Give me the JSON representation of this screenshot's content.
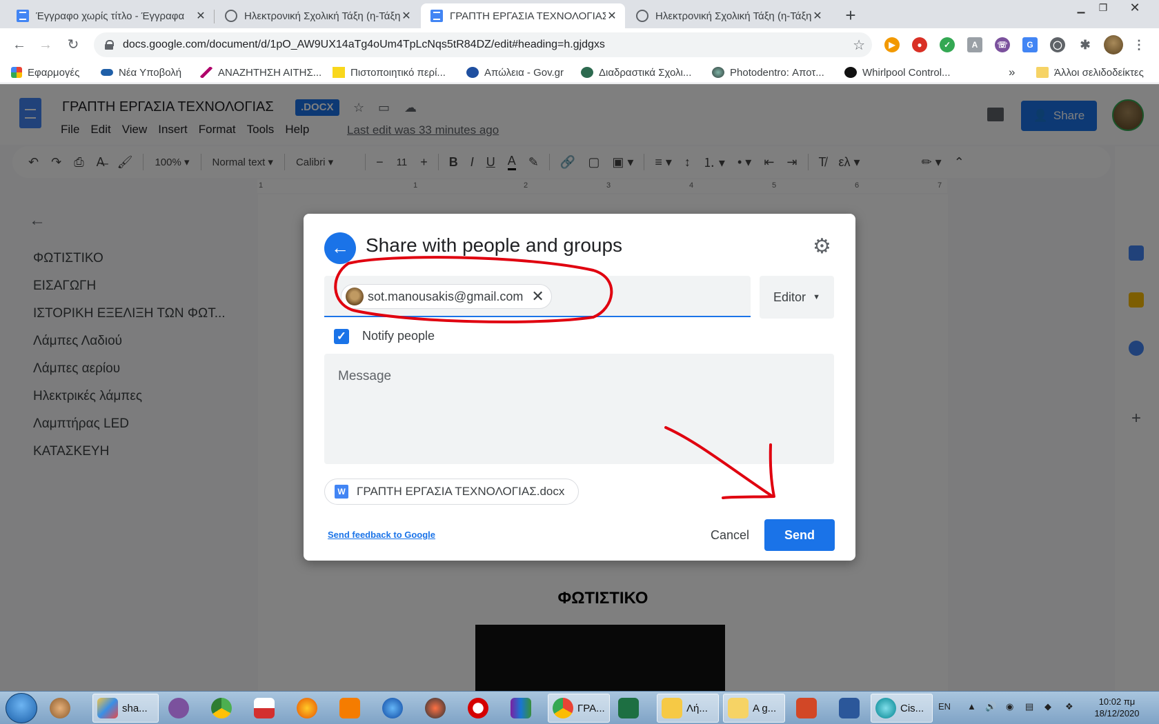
{
  "browser": {
    "tabs": [
      {
        "title": "Έγγραφο χωρίς τίτλο - Έγγραφα",
        "icon": "docs-icon",
        "active": false
      },
      {
        "title": "Ηλεκτρονική Σχολική Τάξη (η-Τάξη)",
        "icon": "eclass-icon",
        "active": false
      },
      {
        "title": "ΓΡΑΠΤΗ ΕΡΓΑΣΙΑ ΤΕΧΝΟΛΟΓΙΑΣ",
        "icon": "docs-icon",
        "active": true
      },
      {
        "title": "Ηλεκτρονική Σχολική Τάξη (η-Τάξη)",
        "icon": "eclass-icon",
        "active": false
      }
    ],
    "url": "docs.google.com/document/d/1pO_AW9UX14aTg4oUm4TpLcNqs5tR84DZ/edit#heading=h.gjdgxs",
    "bookmarks": [
      {
        "label": "Εφαρμογές"
      },
      {
        "label": "Νέα Υποβολή"
      },
      {
        "label": "ΑΝΑΖΗΤΗΣΗ ΑΙΤΗΣ..."
      },
      {
        "label": "Πιστοποιητικό περί..."
      },
      {
        "label": "Απώλεια - Gov.gr"
      },
      {
        "label": "Διαδραστικά Σχολι..."
      },
      {
        "label": "Photodentro: Αποτ..."
      },
      {
        "label": "Whirlpool Control..."
      }
    ],
    "bookmarks_overflow": "»",
    "other_bookmarks": "Άλλοι σελιδοδείκτες"
  },
  "docs": {
    "title": "ΓΡΑΠΤΗ ΕΡΓΑΣΙΑ ΤΕΧΝΟΛΟΓΙΑΣ",
    "badge": ".DOCX",
    "menu": [
      "File",
      "Edit",
      "View",
      "Insert",
      "Format",
      "Tools",
      "Help"
    ],
    "last_edit": "Last edit was 33 minutes ago",
    "share_label": "Share",
    "toolbar": {
      "zoom": "100%",
      "style": "Normal text",
      "font": "Calibri",
      "font_size": "11"
    },
    "ruler": [
      "1",
      "1",
      "2",
      "3",
      "4",
      "5",
      "6",
      "7"
    ],
    "outline": [
      "ΦΩΤΙΣΤΙΚΟ",
      "ΕΙΣΑΓΩΓΗ",
      "ΙΣΤΟΡΙΚΗ ΕΞΕΛΙΞΗ ΤΩΝ ΦΩΤ...",
      "Λάμπες Λαδιού",
      "Λάμπες αερίου",
      "Ηλεκτρικές λάμπες",
      "Λαμπτήρας LED",
      "ΚΑΤΑΣΚΕΥΗ"
    ],
    "page_heading": "ΦΩΤΙΣΤΙΚΟ"
  },
  "dialog": {
    "title": "Share with people and groups",
    "recipient": "sot.manousakis@gmail.com",
    "role": "Editor",
    "notify_label": "Notify people",
    "notify_checked": true,
    "message_placeholder": "Message",
    "attachment": "ΓΡΑΠΤΗ ΕΡΓΑΣΙΑ ΤΕΧΝΟΛΟΓΙΑΣ.docx",
    "feedback": "Send feedback to Google",
    "cancel": "Cancel",
    "send": "Send"
  },
  "taskbar": {
    "items": [
      {
        "label": "sha..."
      },
      {
        "label": "ΓΡΑ..."
      },
      {
        "label": "Λή..."
      },
      {
        "label": "A g..."
      },
      {
        "label": "Cis..."
      }
    ],
    "lang": "EN",
    "time": "10:02 πμ",
    "date": "18/12/2020"
  },
  "colors": {
    "accent": "#1a73e8",
    "annotation": "#e0000f"
  }
}
